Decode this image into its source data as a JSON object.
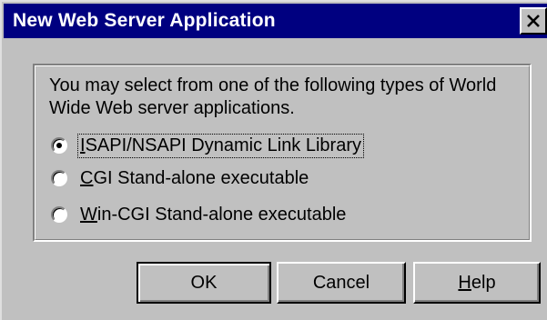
{
  "dialog": {
    "title": "New Web Server Application",
    "close_icon": "close-icon"
  },
  "group": {
    "description": "You may select from one of the following types of World Wide Web server applications.",
    "options": [
      {
        "label_first": "I",
        "label_rest": "SAPI/NSAPI Dynamic Link Library",
        "selected": true
      },
      {
        "label_first": "C",
        "label_rest": "GI Stand-alone executable",
        "selected": false
      },
      {
        "label_first": "W",
        "label_rest": "in-CGI Stand-alone executable",
        "selected": false
      }
    ]
  },
  "buttons": {
    "ok": "OK",
    "cancel": "Cancel",
    "help_first": "H",
    "help_rest": "elp"
  }
}
